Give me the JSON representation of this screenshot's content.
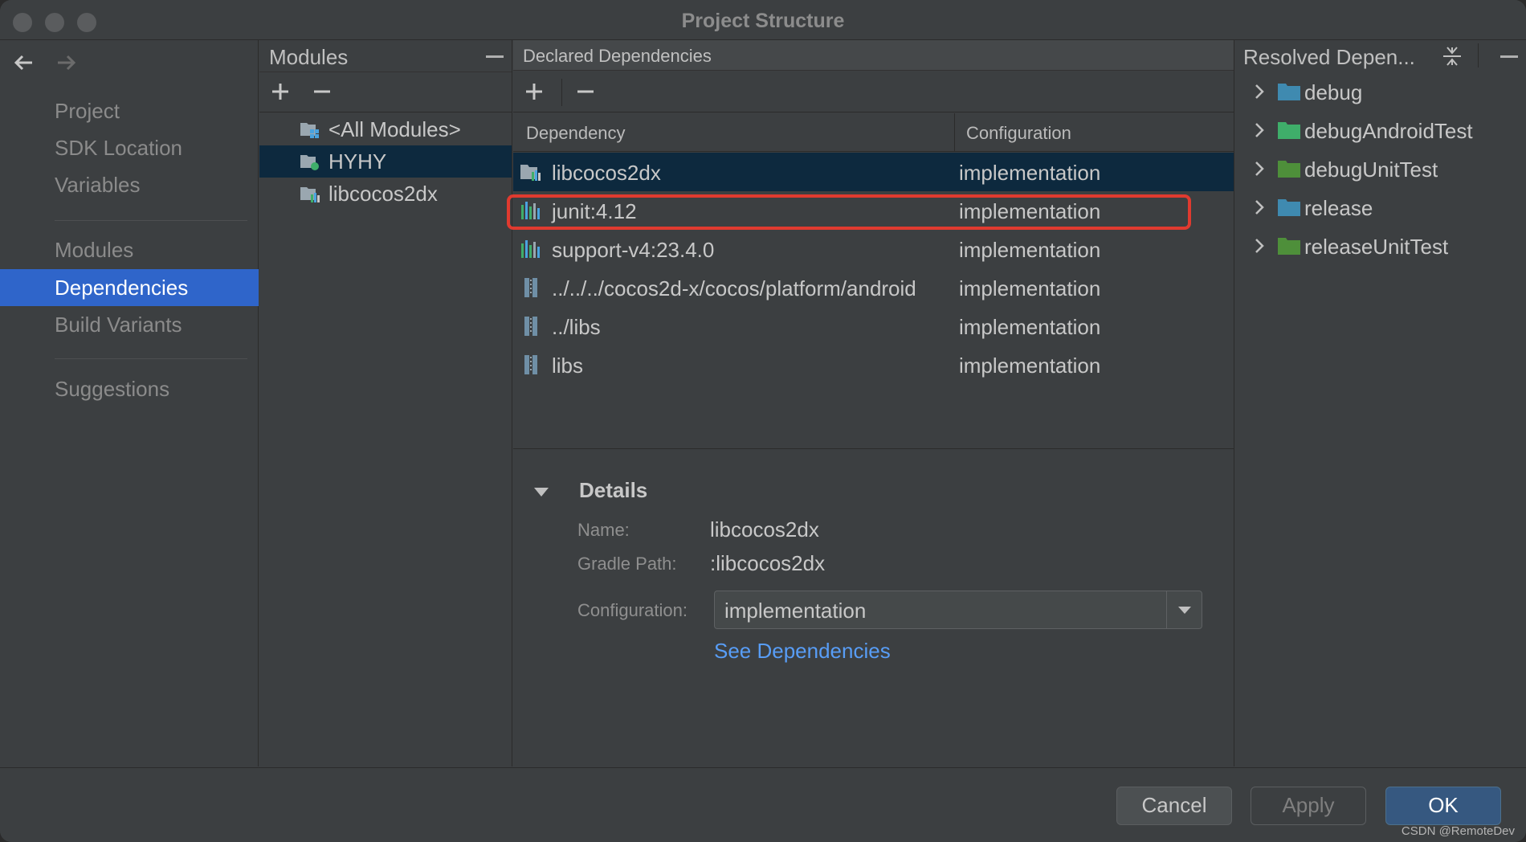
{
  "window": {
    "title": "Project Structure"
  },
  "nav": {
    "back_icon": "arrow-left-icon",
    "forward_icon": "arrow-right-icon",
    "items": [
      {
        "label": "Project"
      },
      {
        "label": "SDK Location"
      },
      {
        "label": "Variables"
      },
      {
        "label": "Modules"
      },
      {
        "label": "Dependencies",
        "active": true
      },
      {
        "label": "Build Variants"
      },
      {
        "label": "Suggestions"
      }
    ]
  },
  "modules": {
    "title": "Modules",
    "items": [
      {
        "label": "<All Modules>",
        "icon": "all-modules-icon"
      },
      {
        "label": "HYHY",
        "icon": "app-module-icon",
        "selected": true
      },
      {
        "label": "libcocos2dx",
        "icon": "library-module-icon"
      }
    ]
  },
  "declared": {
    "title": "Declared Dependencies",
    "columns": [
      "Dependency",
      "Configuration"
    ],
    "rows": [
      {
        "name": "libcocos2dx",
        "config": "implementation",
        "icon": "module-dependency-icon",
        "selected": true
      },
      {
        "name": "junit:4.12",
        "config": "implementation",
        "icon": "library-bars-icon",
        "highlighted": true
      },
      {
        "name": "support-v4:23.4.0",
        "config": "implementation",
        "icon": "library-bars-icon"
      },
      {
        "name": "../../../cocos2d-x/cocos/platform/android",
        "config": "implementation",
        "icon": "jar-icon"
      },
      {
        "name": "../libs",
        "config": "implementation",
        "icon": "jar-icon"
      },
      {
        "name": "libs",
        "config": "implementation",
        "icon": "jar-icon"
      }
    ]
  },
  "details": {
    "title": "Details",
    "name_label": "Name:",
    "name_value": "libcocos2dx",
    "path_label": "Gradle Path:",
    "path_value": ":libcocos2dx",
    "config_label": "Configuration:",
    "config_value": "implementation",
    "link": "See Dependencies"
  },
  "resolved": {
    "title": "Resolved Depen...",
    "items": [
      {
        "label": "debug",
        "color": "#3f8ab0"
      },
      {
        "label": "debugAndroidTest",
        "color": "#3fae6a"
      },
      {
        "label": "debugUnitTest",
        "color": "#4e8f3a"
      },
      {
        "label": "release",
        "color": "#3f8ab0"
      },
      {
        "label": "releaseUnitTest",
        "color": "#4e8f3a"
      }
    ]
  },
  "footer": {
    "cancel": "Cancel",
    "apply": "Apply",
    "ok": "OK",
    "watermark": "CSDN @RemoteDev"
  },
  "colors": {
    "accent": "#2f65ca",
    "selection": "#0d293e",
    "highlight_border": "#e03a2f",
    "link": "#589df6"
  }
}
